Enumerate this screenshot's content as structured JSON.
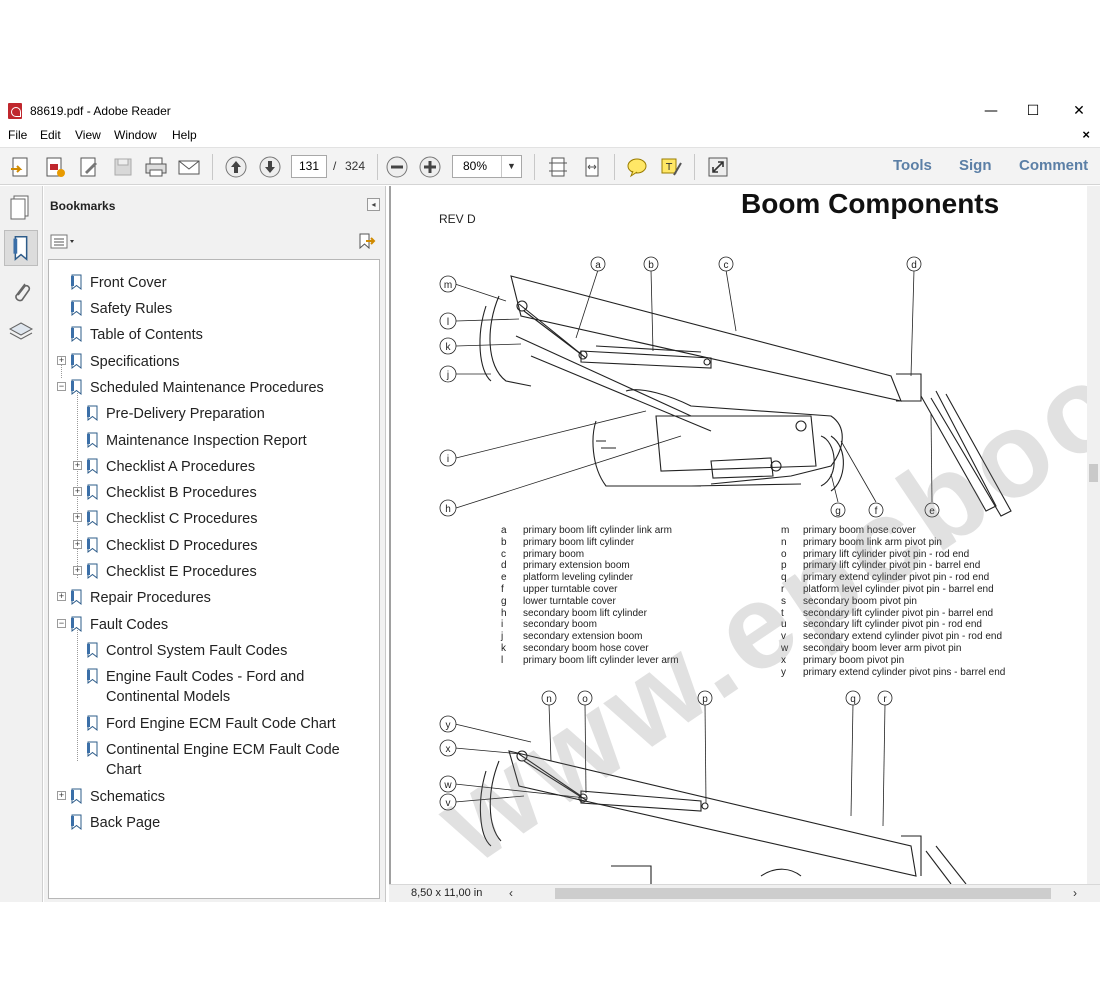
{
  "window": {
    "title": "88619.pdf - Adobe Reader",
    "minimize": "—",
    "maximize": "☐",
    "close": "✕"
  },
  "menu": {
    "items": [
      "File",
      "Edit",
      "View",
      "Window",
      "Help"
    ],
    "close_doc": "×"
  },
  "toolbar": {
    "current_page": "131",
    "page_separator": "/",
    "total_pages": "324",
    "zoom": "80%",
    "tools_label": "Tools",
    "sign_label": "Sign",
    "comment_label": "Comment"
  },
  "bookmarks": {
    "title": "Bookmarks",
    "items": [
      {
        "label": "Front Cover"
      },
      {
        "label": "Safety Rules"
      },
      {
        "label": "Table of Contents"
      },
      {
        "label": "Specifications"
      },
      {
        "label": "Scheduled Maintenance Procedures"
      },
      {
        "label": "Pre-Delivery Preparation"
      },
      {
        "label": "Maintenance Inspection Report"
      },
      {
        "label": "Checklist A Procedures"
      },
      {
        "label": "Checklist B Procedures"
      },
      {
        "label": "Checklist C Procedures"
      },
      {
        "label": "Checklist D Procedures"
      },
      {
        "label": "Checklist E Procedures"
      },
      {
        "label": "Repair Procedures"
      },
      {
        "label": "Fault Codes"
      },
      {
        "label": "Control System Fault Codes"
      },
      {
        "label": "Engine Fault Codes - Ford and",
        "label2": "Continental Models"
      },
      {
        "label": "Ford Engine ECM Fault Code Chart"
      },
      {
        "label": "Continental Engine ECM Fault Code",
        "label2": "Chart"
      },
      {
        "label": "Schematics"
      },
      {
        "label": "Back Page"
      }
    ]
  },
  "document": {
    "page_title": "Boom Components",
    "revision": "REV D",
    "page_size": "8,50 x 11,00 in",
    "legend_left": [
      {
        "key": "a",
        "text": "primary boom lift cylinder link arm"
      },
      {
        "key": "b",
        "text": "primary boom lift cylinder"
      },
      {
        "key": "c",
        "text": "primary boom"
      },
      {
        "key": "d",
        "text": "primary extension boom"
      },
      {
        "key": "e",
        "text": "platform leveling cylinder"
      },
      {
        "key": "f",
        "text": "upper turntable cover"
      },
      {
        "key": "g",
        "text": "lower turntable cover"
      },
      {
        "key": "h",
        "text": "secondary boom lift cylinder"
      },
      {
        "key": "i",
        "text": "secondary boom"
      },
      {
        "key": "j",
        "text": "secondary extension boom"
      },
      {
        "key": "k",
        "text": "secondary boom hose cover"
      },
      {
        "key": "l",
        "text": "primary boom lift cylinder lever arm"
      }
    ],
    "legend_right": [
      {
        "key": "m",
        "text": "primary boom hose cover"
      },
      {
        "key": "n",
        "text": "primary boom link arm pivot pin"
      },
      {
        "key": "o",
        "text": "primary lift cylinder pivot pin - rod end"
      },
      {
        "key": "p",
        "text": "primary lift cylinder pivot pin - barrel end"
      },
      {
        "key": "q",
        "text": "primary extend cylinder pivot pin - rod end"
      },
      {
        "key": "r",
        "text": "platform level cylinder pivot pin - barrel end"
      },
      {
        "key": "s",
        "text": "secondary boom pivot pin"
      },
      {
        "key": "t",
        "text": "secondary lift cylinder pivot pin - barrel end"
      },
      {
        "key": "u",
        "text": "secondary lift cylinder pivot pin - rod end"
      },
      {
        "key": "v",
        "text": "secondary extend cylinder pivot pin - rod end"
      },
      {
        "key": "w",
        "text": "secondary boom lever arm pivot pin"
      },
      {
        "key": "x",
        "text": "primary boom pivot pin"
      },
      {
        "key": "y",
        "text": "primary extend cylinder pivot pins - barrel end"
      }
    ],
    "callouts_top": [
      "a",
      "b",
      "c",
      "d",
      "m",
      "l",
      "k",
      "j",
      "i",
      "h",
      "g",
      "f",
      "e"
    ],
    "callouts_bottom": [
      "n",
      "o",
      "p",
      "q",
      "r",
      "y",
      "x",
      "w",
      "v"
    ],
    "watermark": "www.epcbook.com"
  }
}
